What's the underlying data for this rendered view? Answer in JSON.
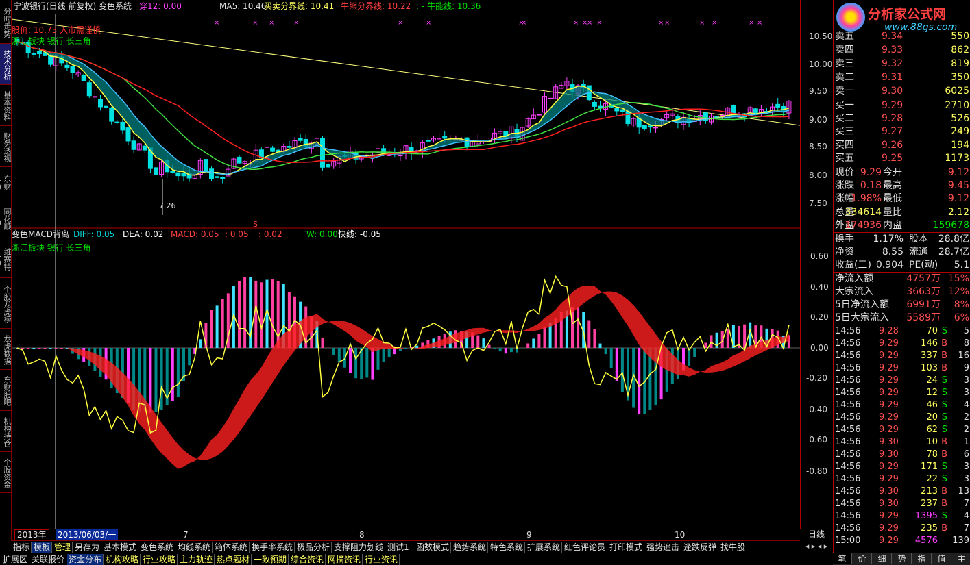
{
  "stock": {
    "title": "宁波银行(日线 前复权) 变色系统",
    "cross": "穿12: 0.00"
  },
  "ma_header": {
    "ma5": "MA5: 10.46",
    "buysell": "买卖分界线: 10.41",
    "bull": "牛熊分界线: 10.22",
    "bull2": ": - 牛能线: 10.36"
  },
  "annot": {
    "line1": "股价: 10.73 入市需谨慎",
    "line2": "浙江板块 银行 长三角",
    "low": "7.26",
    "s_mark": "S"
  },
  "macd_header": {
    "name": "变色MACD背离",
    "diff": "DIFF: 0.05",
    "dea": "DEA: 0.02",
    "macd": "MACD: 0.05",
    "v1": ": 0.05",
    "v2": ": 0.02",
    "w": "W: 0.00",
    "fast": "快线: -0.05",
    "sub": "浙江板块 银行 长三角"
  },
  "price_axis": [
    "10.50",
    "10.00",
    "9.50",
    "9.00",
    "8.50",
    "8.00",
    "7.50"
  ],
  "macd_axis": [
    "0.60",
    "0.40",
    "0.20",
    "0.00",
    "-0.20",
    "-0.40",
    "-0.60",
    "-0.80"
  ],
  "dates": {
    "year": "2013年",
    "cursor": "2013/06/03/一",
    "m7": "7",
    "m8": "8",
    "m9": "9",
    "m10": "10",
    "period": "日线"
  },
  "left_tabs": [
    "分时走势",
    "技术分析",
    "基本资料",
    "财务透视",
    "东财10",
    "同花顺10",
    "维赛特10",
    "个股龙虎榜",
    "龙虎数据",
    "东财股吧",
    "机构持仓",
    "个股资金"
  ],
  "tabs1": [
    "指标",
    "模板",
    "管理",
    "另存为",
    "基本模式",
    "变色系统",
    "均线系统",
    "箱体系统",
    "换手率系统",
    "极品分析",
    "支撑阻力划线",
    "测试1",
    "函数模式",
    "趋势系统",
    "特色系统",
    "扩展系统",
    "红色评论员",
    "打印模式",
    "强势追击",
    "逢跌反弹",
    "找牛股"
  ],
  "tabs2": [
    "扩展区",
    "关联报价",
    "资金分布",
    "机构攻略",
    "行业攻略",
    "主力轨迹",
    "热点题材",
    "一致预期",
    "综合资讯",
    "网摘资讯",
    "行业资讯"
  ],
  "logo": {
    "text": "分析家公式网",
    "url": "www.88gs.com"
  },
  "sells": [
    {
      "label": "卖五",
      "price": "9.34",
      "vol": "550"
    },
    {
      "label": "卖四",
      "price": "9.33",
      "vol": "862"
    },
    {
      "label": "卖三",
      "price": "9.32",
      "vol": "819"
    },
    {
      "label": "卖二",
      "price": "9.31",
      "vol": "350"
    },
    {
      "label": "卖一",
      "price": "9.30",
      "vol": "6025"
    }
  ],
  "buys": [
    {
      "label": "买一",
      "price": "9.29",
      "vol": "2710"
    },
    {
      "label": "买二",
      "price": "9.28",
      "vol": "526"
    },
    {
      "label": "买三",
      "price": "9.27",
      "vol": "249"
    },
    {
      "label": "买四",
      "price": "9.26",
      "vol": "194"
    },
    {
      "label": "买五",
      "price": "9.25",
      "vol": "1173"
    }
  ],
  "stats": [
    {
      "l1": "现价",
      "v1": "9.29",
      "l2": "今开",
      "v2": "9.12"
    },
    {
      "l1": "涨跌",
      "v1": "0.18",
      "l2": "最高",
      "v2": "9.45"
    },
    {
      "l1": "涨幅",
      "v1": "1.98%",
      "l2": "最低",
      "v2": "9.12"
    },
    {
      "l1": "总量",
      "v1": "334614",
      "l2": "量比",
      "v2": "2.12"
    },
    {
      "l1": "外盘",
      "v1": "174936",
      "l2": "内盘",
      "v2": "159678"
    }
  ],
  "fund": [
    {
      "l1": "换手",
      "v1": "1.17%",
      "l2": "股本",
      "v2": "28.8亿"
    },
    {
      "l1": "净资",
      "v1": "8.55",
      "l2": "流通",
      "v2": "28.7亿"
    },
    {
      "l1": "收益(三)",
      "v1": "0.904",
      "l2": "PE(动)",
      "v2": "5.1"
    }
  ],
  "flow": [
    {
      "label": "净流入额",
      "val": "4757万",
      "pct": "15%"
    },
    {
      "label": "大宗流入",
      "val": "3663万",
      "pct": "12%"
    },
    {
      "label": "5日净流入额",
      "val": "6991万",
      "pct": "8%"
    },
    {
      "label": "5日大宗流入",
      "val": "5589万",
      "pct": "6%"
    }
  ],
  "ticks": [
    {
      "t": "14:56",
      "p": "9.28",
      "v": "70",
      "d": "S",
      "n": "5"
    },
    {
      "t": "14:56",
      "p": "9.29",
      "v": "146",
      "d": "B",
      "n": "8"
    },
    {
      "t": "14:56",
      "p": "9.29",
      "v": "337",
      "d": "B",
      "n": "16"
    },
    {
      "t": "14:56",
      "p": "9.29",
      "v": "103",
      "d": "B",
      "n": "9"
    },
    {
      "t": "14:56",
      "p": "9.29",
      "v": "24",
      "d": "S",
      "n": "3"
    },
    {
      "t": "14:56",
      "p": "9.29",
      "v": "12",
      "d": "S",
      "n": "3"
    },
    {
      "t": "14:56",
      "p": "9.29",
      "v": "46",
      "d": "S",
      "n": "4"
    },
    {
      "t": "14:56",
      "p": "9.29",
      "v": "20",
      "d": "S",
      "n": "2"
    },
    {
      "t": "14:56",
      "p": "9.29",
      "v": "62",
      "d": "S",
      "n": "2"
    },
    {
      "t": "14:56",
      "p": "9.30",
      "v": "10",
      "d": "B",
      "n": "1"
    },
    {
      "t": "14:56",
      "p": "9.30",
      "v": "78",
      "d": "B",
      "n": "6"
    },
    {
      "t": "14:56",
      "p": "9.29",
      "v": "171",
      "d": "S",
      "n": "3"
    },
    {
      "t": "14:56",
      "p": "9.29",
      "v": "22",
      "d": "S",
      "n": "3"
    },
    {
      "t": "14:56",
      "p": "9.30",
      "v": "213",
      "d": "B",
      "n": "13"
    },
    {
      "t": "14:56",
      "p": "9.30",
      "v": "237",
      "d": "B",
      "n": "7"
    },
    {
      "t": "14:56",
      "p": "9.29",
      "v": "1395",
      "d": "S",
      "n": "4"
    },
    {
      "t": "14:56",
      "p": "9.29",
      "v": "235",
      "d": "B",
      "n": "7"
    },
    {
      "t": "15:00",
      "p": "9.29",
      "v": "4576",
      "d": "",
      "n": "139"
    }
  ],
  "bottom_tabs": [
    "笔",
    "价",
    "细",
    "势",
    "指",
    "值",
    "主"
  ],
  "colors": {
    "up": "#ff3030",
    "down": "#00e0e0",
    "axis": "#b00000",
    "yellow": "#ffff00"
  }
}
